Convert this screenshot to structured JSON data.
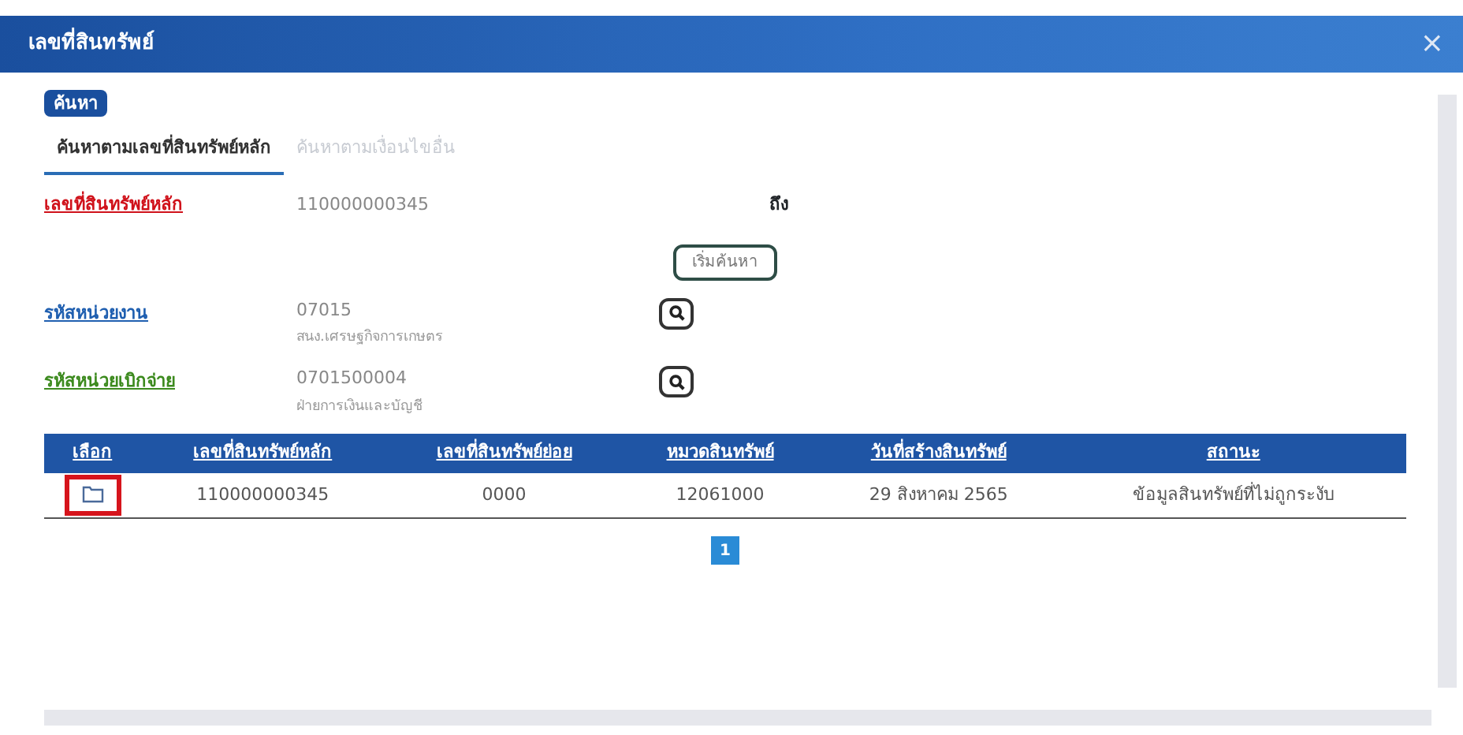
{
  "window": {
    "title": "เลขที่สินทรัพย์",
    "close": "×"
  },
  "section_badge": "ค้นหา",
  "tabs": [
    {
      "label": "ค้นหาตามเลขที่สินทรัพย์หลัก",
      "selected": true
    },
    {
      "label": "ค้นหาตามเงื่อนไขอื่น",
      "selected": false
    }
  ],
  "range": {
    "label": "เลขที่สินทรัพย์หลัก",
    "color": "#d0121b",
    "value": "110000000345",
    "to_label": "ถึง"
  },
  "search_button": "เริ่มค้นหา",
  "fields": [
    {
      "label": "รหัสหน่วยงาน",
      "color": "#1f5fb0",
      "value": "07015",
      "description": "สนง.เศรษฐกิจการเกษตร"
    },
    {
      "label": "รหัสหน่วยเบิกจ่าย",
      "color": "#3c8a1e",
      "value": "0701500004",
      "description": "ฝ่ายการเงินและบัญชี"
    }
  ],
  "table": {
    "columns": [
      "เลือก",
      "เลขที่สินทรัพย์หลัก",
      "เลขที่สินทรัพย์ย่อย",
      "หมวดสินทรัพย์",
      "วันที่สร้างสินทรัพย์",
      "สถานะ"
    ],
    "rows": [
      {
        "highlighted": true,
        "cells": [
          "",
          "110000000345",
          "0000",
          "12061000",
          "29 สิงหาคม 2565",
          "ข้อมูลสินทรัพย์ที่ไม่ถูกระงับ"
        ]
      }
    ]
  },
  "pagination": [
    {
      "label": "1",
      "selected": true
    }
  ]
}
